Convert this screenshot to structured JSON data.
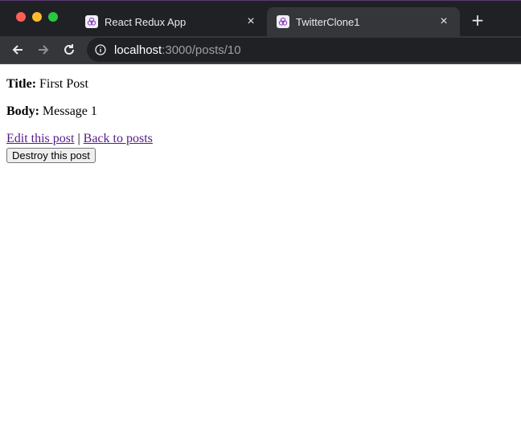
{
  "browser": {
    "tabs": [
      {
        "title": "React Redux App",
        "active": false
      },
      {
        "title": "TwitterClone1",
        "active": true
      }
    ],
    "close_glyph": "×",
    "new_tab_glyph": "+",
    "url_host": "localhost",
    "url_path": ":3000/posts/10",
    "traffic_colors": [
      "#ff5f57",
      "#febc2e",
      "#28c840"
    ]
  },
  "post": {
    "title_label": "Title:",
    "title_value": " First Post",
    "body_label": "Body:",
    "body_value": " Message 1"
  },
  "actions": {
    "edit_link": "Edit this post",
    "separator": " | ",
    "back_link": "Back to posts",
    "destroy_button": "Destroy this post"
  }
}
